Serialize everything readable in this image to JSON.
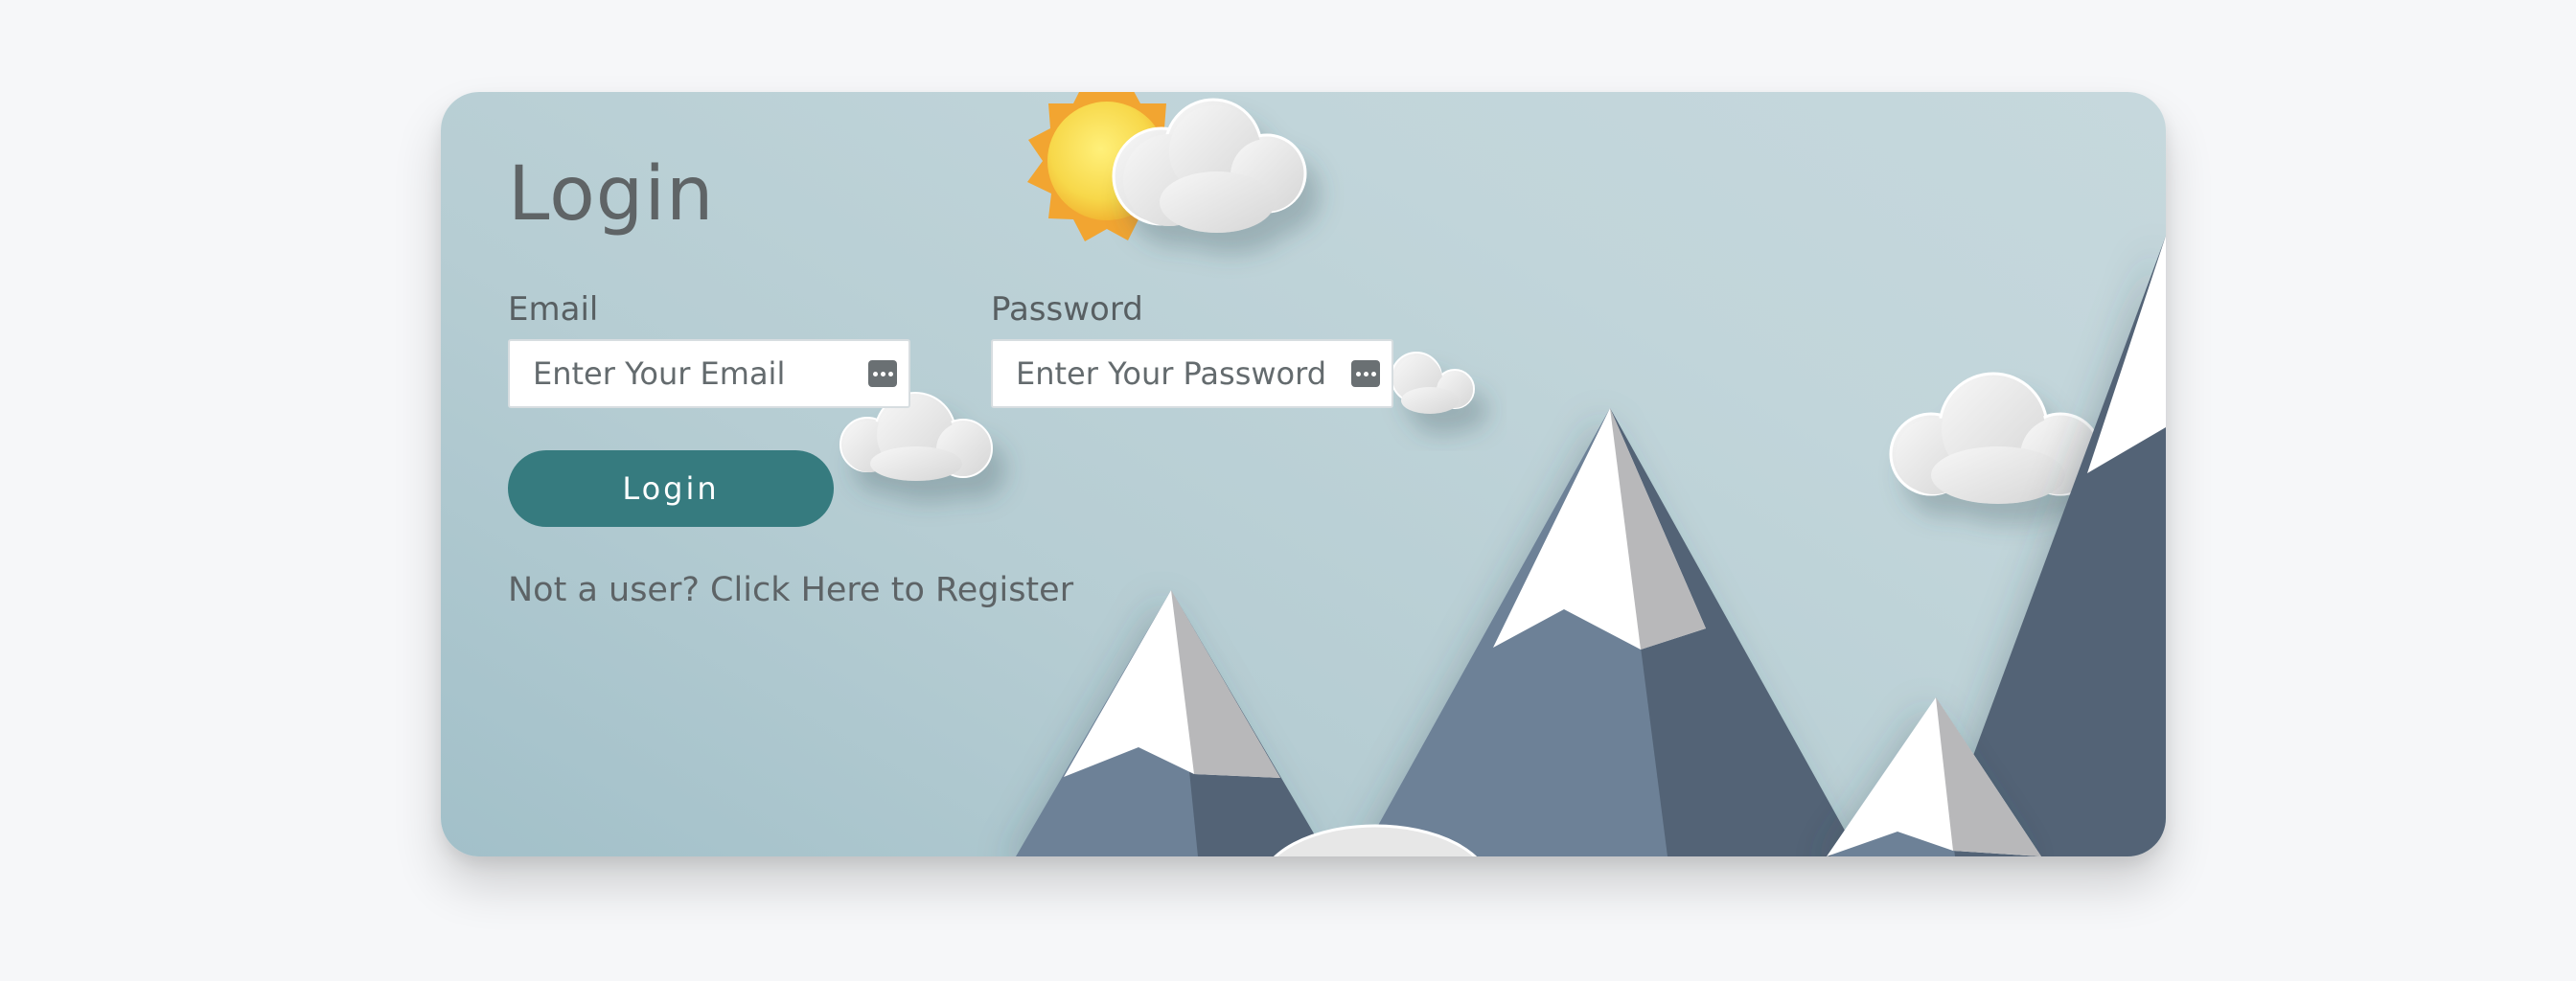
{
  "login_form": {
    "title": "Login",
    "email": {
      "label": "Email",
      "value": "",
      "placeholder": "Enter Your Email",
      "icon": "password-manager-icon"
    },
    "password": {
      "label": "Password",
      "value": "",
      "placeholder": "Enter Your Password",
      "icon": "password-manager-icon"
    },
    "submit_label": "Login",
    "register_text": "Not a user? Click Here to Register"
  },
  "colors": {
    "page_background": "#f6f7f9",
    "card_background": "#c1d5da",
    "button": "#367b7f",
    "text": "#5f6466",
    "mountain_light": "#6d8197",
    "mountain_dark": "#536376",
    "snow": "#ffffff",
    "sun": "#f7dc50"
  }
}
